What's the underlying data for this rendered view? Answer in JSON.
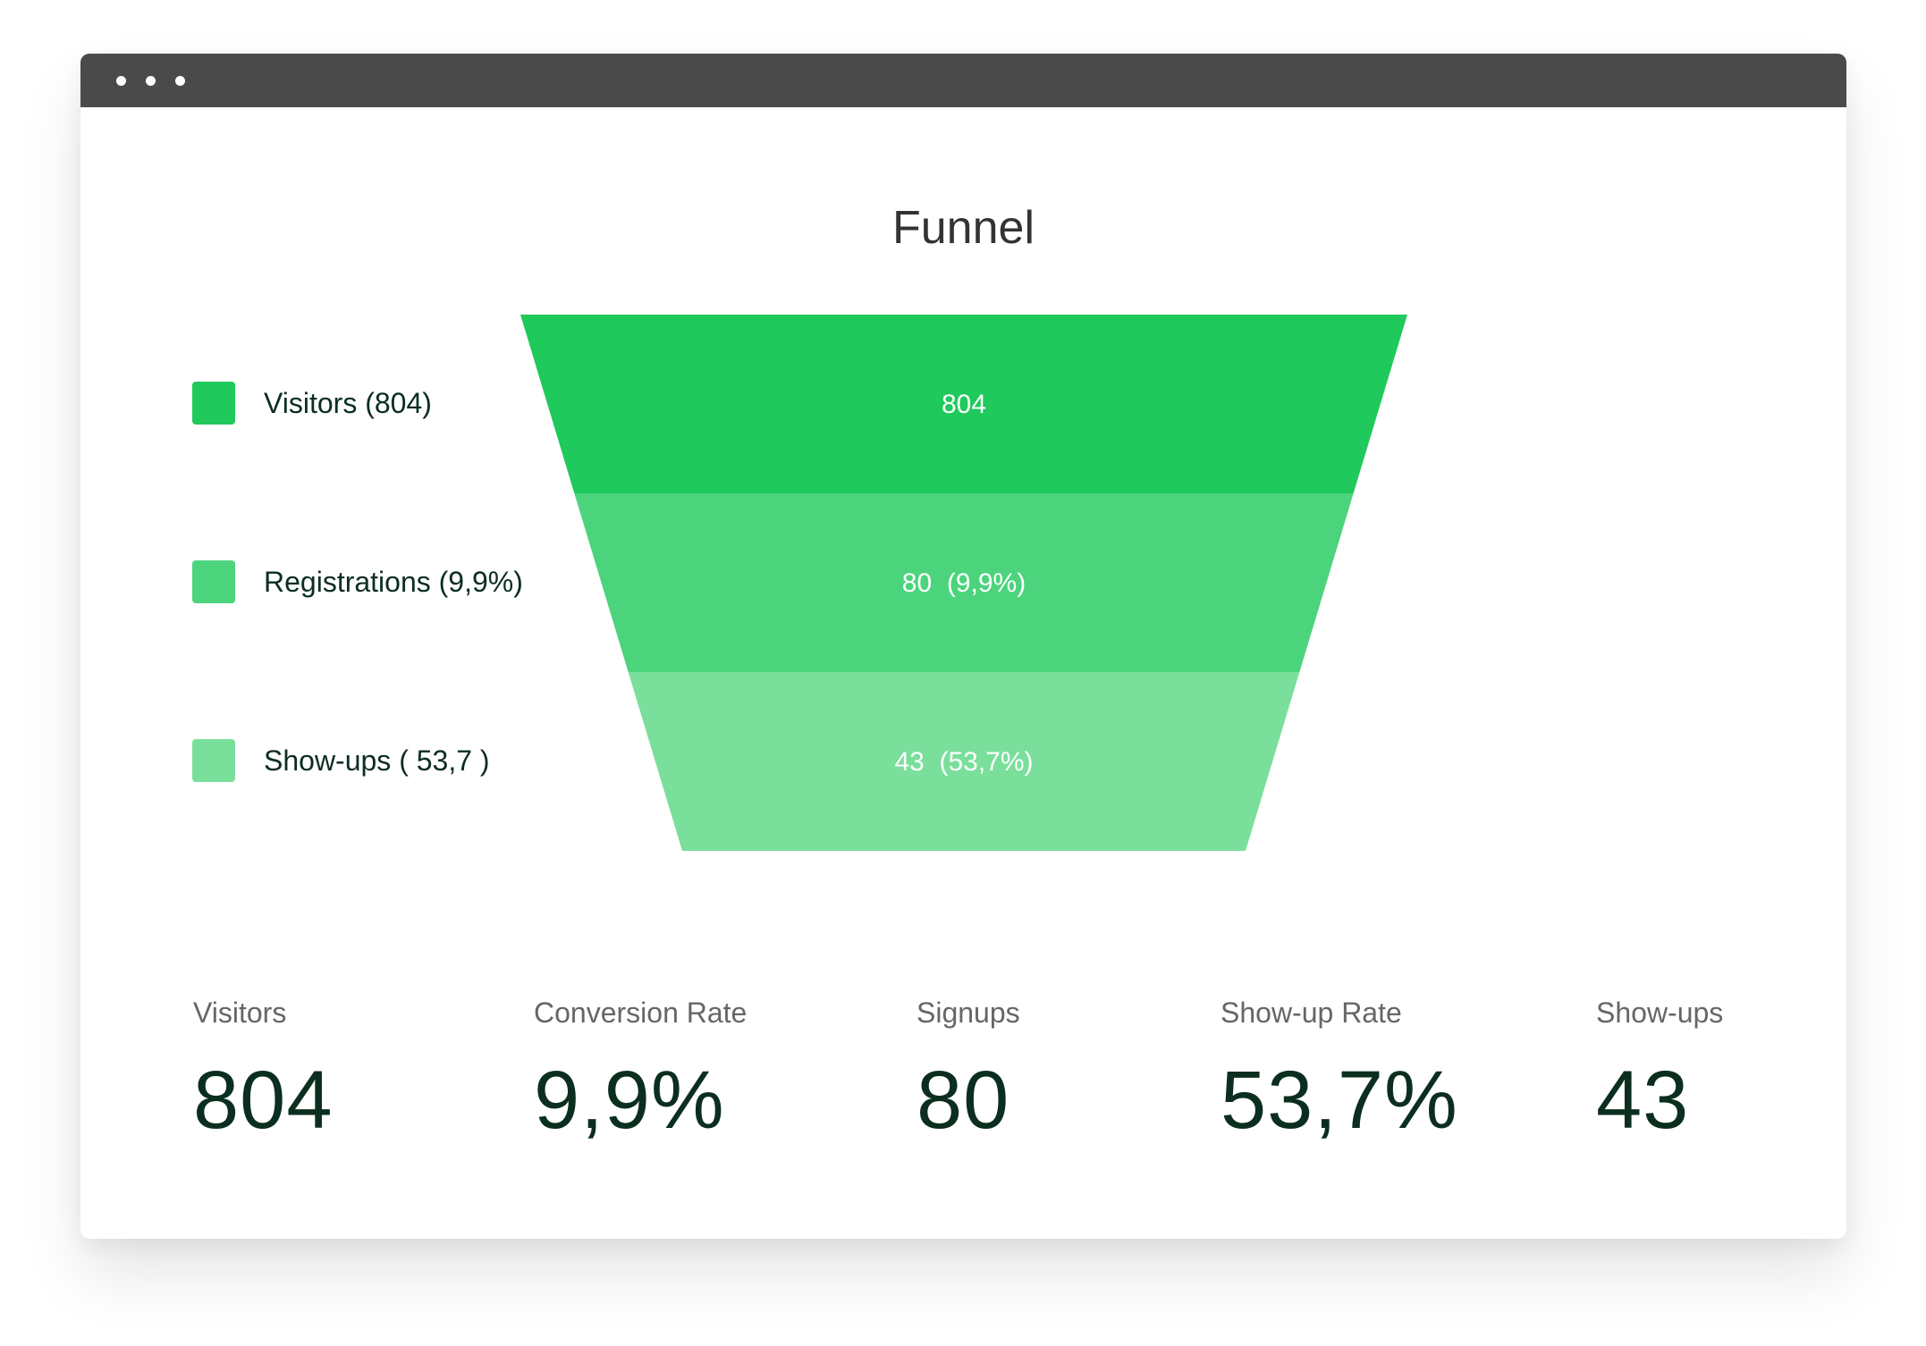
{
  "window": {
    "controls": [
      "dot-icon",
      "dot-icon",
      "dot-icon"
    ]
  },
  "colors": {
    "titlebar": "#4a4a4a",
    "stage_1": "#1fc95b",
    "stage_2": "#4bd47c",
    "stage_3": "#7adf9b",
    "text_dark": "#0b2e1f",
    "text_muted": "#666666"
  },
  "chart_data": {
    "type": "funnel",
    "title": "Funnel",
    "stages": [
      {
        "name": "Visitors",
        "value": 804,
        "label": "804",
        "legend": "Visitors (804)"
      },
      {
        "name": "Registrations",
        "value": 80,
        "percent": 9.9,
        "label": "80  (9,9%)",
        "legend": "Registrations (9,9%)"
      },
      {
        "name": "Show-ups",
        "value": 43,
        "percent": 53.7,
        "label": "43  (53,7%)",
        "legend": "Show-ups ( 53,7 )"
      }
    ],
    "legend_position": "left"
  },
  "stats": [
    {
      "label": "Visitors",
      "value": "804"
    },
    {
      "label": "Conversion Rate",
      "value": "9,9%"
    },
    {
      "label": "Signups",
      "value": "80"
    },
    {
      "label": "Show-up Rate",
      "value": "53,7%"
    },
    {
      "label": "Show-ups",
      "value": "43"
    }
  ]
}
